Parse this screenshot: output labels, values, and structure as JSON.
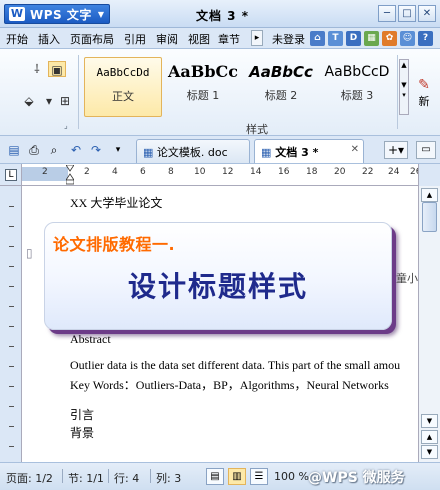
{
  "app": {
    "name": "WPS 文字",
    "logo_glyph": "W"
  },
  "window": {
    "title": "文档 3 *",
    "controls": [
      "─",
      "□",
      "✕"
    ]
  },
  "menu": {
    "tabs": [
      "开始",
      "插入",
      "页面布局",
      "引用",
      "审阅",
      "视图",
      "章节"
    ],
    "more_glyph": "▸",
    "login_label": "未登录",
    "quick_icons": [
      {
        "name": "home-icon",
        "glyph": "⌂",
        "color": "#4a7cc9"
      },
      {
        "name": "skin-icon",
        "glyph": "T",
        "color": "#5a8fd6"
      },
      {
        "name": "font-icon",
        "glyph": "D",
        "color": "#3b6fc0"
      },
      {
        "name": "apps-icon",
        "glyph": "▦",
        "color": "#6aa84f"
      },
      {
        "name": "gift-icon",
        "glyph": "✿",
        "color": "#e07b2a"
      },
      {
        "name": "service-icon",
        "glyph": "☺",
        "color": "#5a8fd6"
      },
      {
        "name": "help-icon",
        "glyph": "?",
        "color": "#3b6fc0"
      }
    ]
  },
  "ribbon": {
    "styles": [
      {
        "sample": "AaBbCcDd",
        "name": "正文"
      },
      {
        "sample": "AaBbCc",
        "name": "标题 1"
      },
      {
        "sample": "AaBbCc",
        "name": "标题 2"
      },
      {
        "sample": "AaBbCcD",
        "name": "标题 3"
      }
    ],
    "group_label": "样式",
    "new_style_label": "新"
  },
  "doctabs": [
    {
      "label": "论文模板. doc"
    },
    {
      "label": "文档 3 *"
    }
  ],
  "ruler": {
    "numbers": [
      "2",
      "2",
      "4",
      "6",
      "8",
      "10",
      "12",
      "14",
      "16",
      "18",
      "20",
      "22",
      "24",
      "26"
    ]
  },
  "document": {
    "lines": [
      {
        "text": "XX 大学毕业论文"
      },
      {
        "text": "Abstract"
      },
      {
        "text": "    Outlier data is the data set different data. This part of the small amou"
      },
      {
        "text": "Key Words：Outliers-Data，BP，Algorithms，Neural Networks"
      },
      {
        "text": "引言"
      },
      {
        "text": "背景"
      }
    ]
  },
  "overlay": {
    "subtitle": "论文排版教程一.",
    "title": "设计标题样式",
    "peek_text": "童小"
  },
  "statusbar": {
    "page": "页面: 1/2",
    "section": "节: 1/1",
    "row": "行: 4",
    "col": "列: 3",
    "zoom": "100 %",
    "watermark": "@WPS 微服务"
  }
}
